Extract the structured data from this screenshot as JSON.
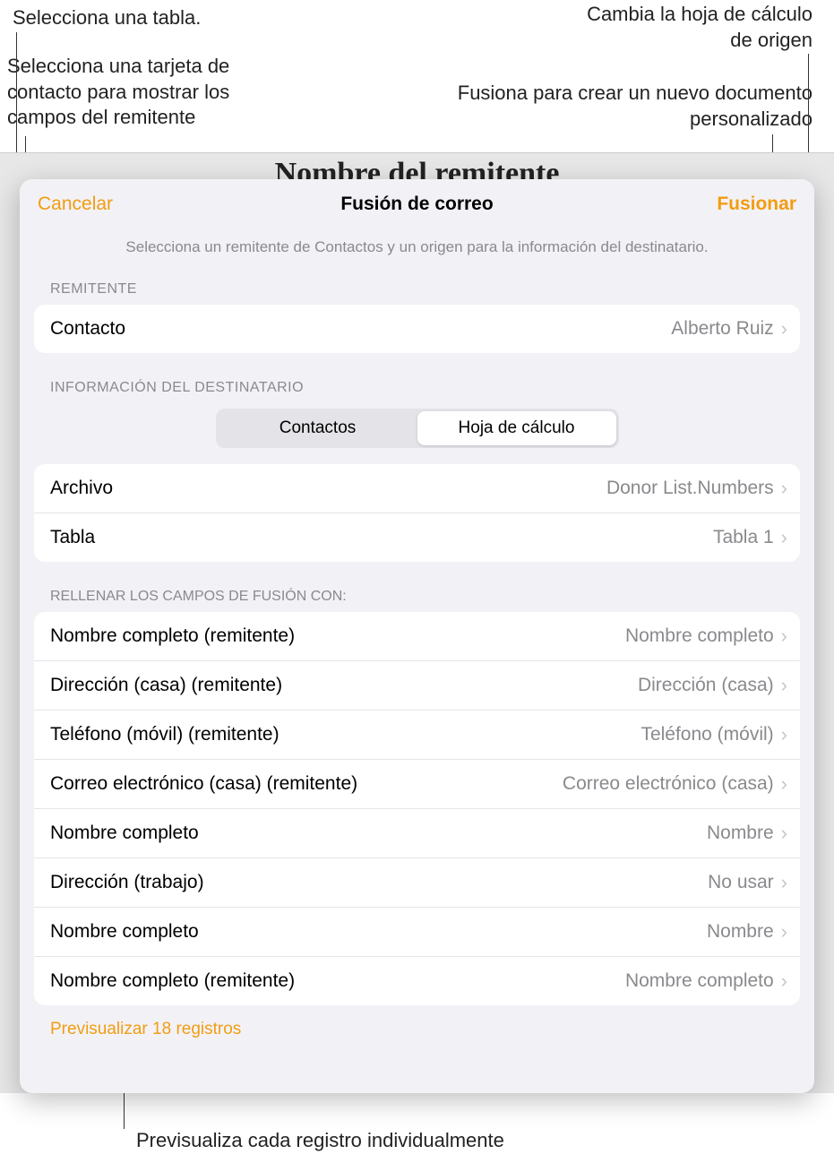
{
  "annotations": {
    "top_left": "Selecciona una tabla.",
    "mid_left": "Selecciona una tarjeta de contacto para mostrar los campos del remitente",
    "top_right": "Cambia la hoja de cálculo de origen",
    "mid_right": "Fusiona para crear un nuevo documento personalizado",
    "bottom": "Previsualiza cada registro individualmente"
  },
  "background_doc_title": "Nombre del remitente",
  "sheet": {
    "title": "Fusión de correo",
    "cancel": "Cancelar",
    "merge": "Fusionar",
    "subtitle": "Selecciona un remitente de Contactos y un origen para la información del destinatario."
  },
  "sender_section": {
    "header": "REMITENTE",
    "contact_label": "Contacto",
    "contact_value": "Alberto Ruiz"
  },
  "recipient_section": {
    "header": "INFORMACIÓN DEL DESTINATARIO",
    "segment_contacts": "Contactos",
    "segment_spreadsheet": "Hoja de cálculo"
  },
  "file_section": {
    "file_label": "Archivo",
    "file_value": "Donor List.Numbers",
    "table_label": "Tabla",
    "table_value": "Tabla 1"
  },
  "fields_section": {
    "header": "RELLENAR LOS CAMPOS DE FUSIÓN CON:",
    "rows": [
      {
        "label": "Nombre completo (remitente)",
        "value": "Nombre completo"
      },
      {
        "label": "Dirección (casa) (remitente)",
        "value": "Dirección (casa)"
      },
      {
        "label": "Teléfono (móvil) (remitente)",
        "value": "Teléfono (móvil)"
      },
      {
        "label": "Correo electrónico (casa) (remitente)",
        "value": "Correo electrónico (casa)"
      },
      {
        "label": "Nombre completo",
        "value": "Nombre"
      },
      {
        "label": "Dirección (trabajo)",
        "value": "No usar"
      },
      {
        "label": "Nombre completo",
        "value": "Nombre"
      },
      {
        "label": "Nombre completo (remitente)",
        "value": "Nombre completo"
      }
    ]
  },
  "preview_link": "Previsualizar 18 registros",
  "colors": {
    "accent": "#f39c12",
    "secondary_text": "#8a8a8e",
    "sheet_bg": "#f2f2f6"
  }
}
